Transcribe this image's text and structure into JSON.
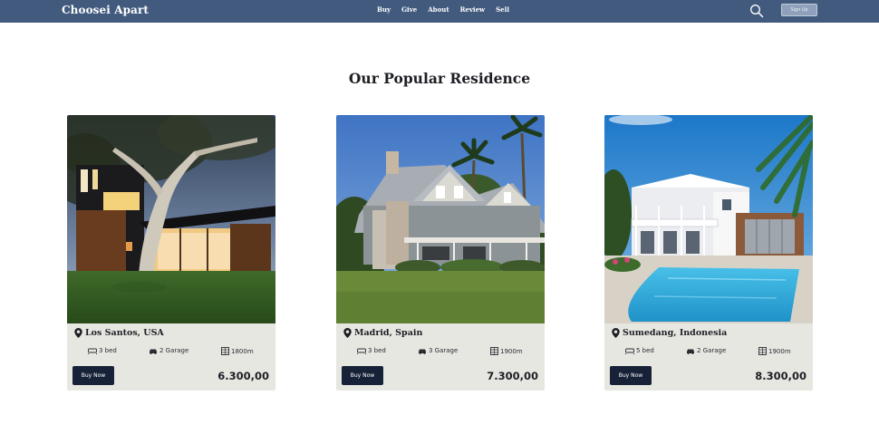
{
  "navbar": {
    "brand": "Choosei Apart",
    "links": [
      "Buy",
      "Give",
      "About",
      "Review",
      "Sell"
    ],
    "signup_label": "Sign Up",
    "search_icon": "search-icon"
  },
  "section": {
    "title": "Our Popular Residence"
  },
  "properties": [
    {
      "location": "Los Santos, USA",
      "bed": "3 bed",
      "garage": "2 Garage",
      "area": "1800m",
      "buy_label": "Buy Now",
      "price": "6.300,00"
    },
    {
      "location": "Madrid, Spain",
      "bed": "3 bed",
      "garage": "3 Garage",
      "area": "1900m",
      "buy_label": "Buy Now",
      "price": "7.300,00"
    },
    {
      "location": "Sumedang, Indonesia",
      "bed": "5 bed",
      "garage": "2 Garage",
      "area": "1900m",
      "buy_label": "Buy Now",
      "price": "8.300,00"
    }
  ],
  "colors": {
    "navbar": "#415a7e",
    "card": "#e7e7e2",
    "button": "#172238"
  }
}
